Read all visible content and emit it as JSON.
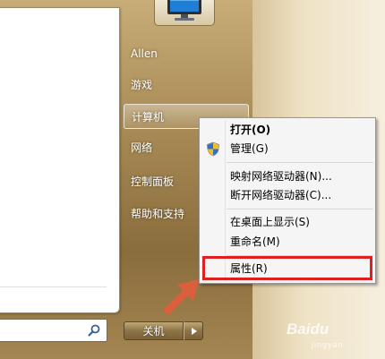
{
  "start_menu": {
    "user_name": "Allen",
    "right_links": [
      "游戏",
      "计算机",
      "网络",
      "控制面板",
      "帮助和支持"
    ],
    "shutdown_label": "关机"
  },
  "context_menu": {
    "items": [
      "打开(O)",
      "管理(G)",
      "映射网络驱动器(N)...",
      "断开网络驱动器(C)...",
      "在桌面上显示(S)",
      "重命名(M)",
      "属性(R)"
    ]
  },
  "watermark": {
    "logo": "Baidu",
    "sub": "jingyan"
  },
  "colors": {
    "highlight": "#e02020",
    "arrow": "#e85a3c"
  }
}
